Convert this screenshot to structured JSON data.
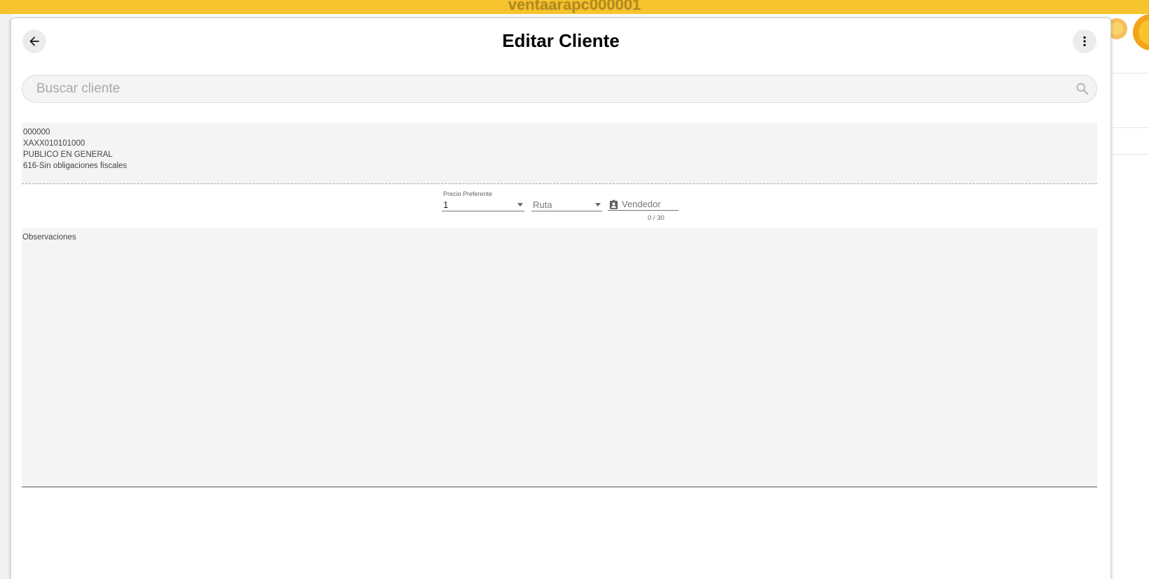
{
  "background": {
    "title": "ventaarapc000001"
  },
  "modal": {
    "title": "Editar Cliente",
    "back_icon": "arrow-left-icon",
    "more_icon": "more-vertical-icon"
  },
  "search": {
    "placeholder": "Buscar cliente",
    "value": "",
    "icon": "search-icon"
  },
  "client": {
    "code": "000000",
    "rfc": "XAXX010101000",
    "name": "PUBLICO EN GENERAL",
    "regimen": "616-Sin obligaciones fiscales"
  },
  "fields": {
    "precio_label": "Precio Preferente",
    "precio_value": "1",
    "ruta_placeholder": "Ruta",
    "vendedor_placeholder": "Vendedor",
    "vendedor_icon": "contact-badge-icon",
    "vendedor_counter": "0 / 30"
  },
  "observaciones": {
    "label": "Observaciones",
    "value": ""
  },
  "colors": {
    "topbar": "#f7c32e",
    "accent_orange": "#f5a31a",
    "panel_bg": "#f4f4f4"
  }
}
